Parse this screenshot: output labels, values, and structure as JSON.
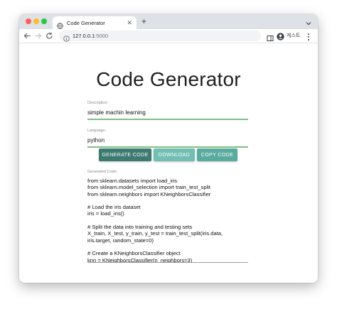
{
  "browser": {
    "tab_title": "Code Generator",
    "new_tab_symbol": "+",
    "url_host": "127.0.0.1",
    "url_port": ":5000",
    "profile_name": "게스트"
  },
  "page": {
    "title": "Code Generator",
    "description": {
      "label": "Description:",
      "value": "simple machin learning"
    },
    "language": {
      "label": "Language:",
      "value": "python"
    },
    "buttons": {
      "generate": "GENERATE CODE",
      "download": "DOWNLOAD",
      "copy": "COPY CODE"
    },
    "output_label": "Generated Code:",
    "code_lines": [
      "from sklearn.datasets import load_iris",
      "from sklearn.model_selection import train_test_split",
      "from sklearn.neighbors import KNeighborsClassifier",
      "",
      "# Load the iris dataset",
      "iris = load_iris()",
      "",
      "# Split the data into training and testing sets",
      "X_train, X_test, y_train, y_test = train_test_split(iris.data,",
      "iris.target, random_state=0)",
      "",
      "# Create a KNeighborsClassifier object",
      "knn = KNeighborsClassifier(n_neighbors=3)"
    ]
  },
  "colors": {
    "generate_button": "#3d7a70",
    "download_button": "#72beb3",
    "copy_button": "#5aab9f",
    "field_underline": "#7cc083"
  },
  "icons": {
    "tab_favicon": "globe-icon",
    "reload": "reload-icon",
    "site_info": "info-icon"
  }
}
